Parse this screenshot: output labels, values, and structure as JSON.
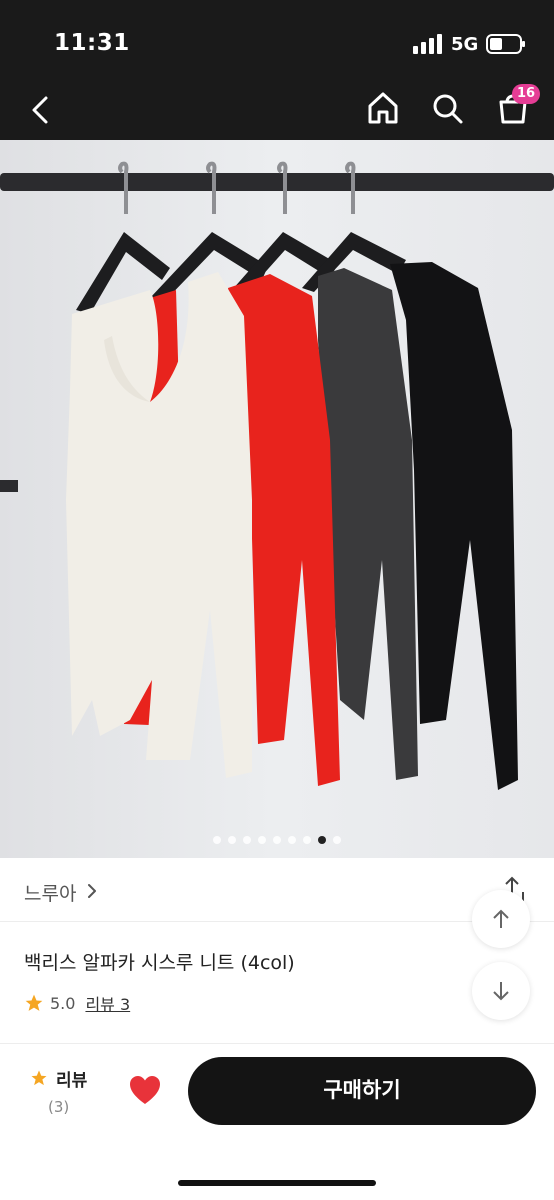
{
  "status_bar": {
    "time": "11:31",
    "network": "5G"
  },
  "header": {
    "cart_badge": "16"
  },
  "gallery": {
    "total_images": 9,
    "current_index": 8
  },
  "product": {
    "shop_name": "느루아",
    "title": "백리스 알파카 시스루 니트 (4col)",
    "rating": "5.0",
    "review_link": "리뷰 3"
  },
  "bottom_bar": {
    "review_label": "리뷰",
    "review_count": "(3)",
    "buy_label": "구매하기"
  },
  "colors": {
    "accent_badge": "#e53d95",
    "star": "#f5a623",
    "heart": "#e8333a",
    "knit_colors": [
      "#f1eee7",
      "#e8231d",
      "#3a3a3c",
      "#121214"
    ]
  },
  "icons": [
    "back-icon",
    "home-icon",
    "search-icon",
    "cart-icon",
    "chevron-right-icon",
    "share-icon",
    "arrow-up-icon",
    "arrow-down-icon",
    "star-icon",
    "heart-icon"
  ]
}
